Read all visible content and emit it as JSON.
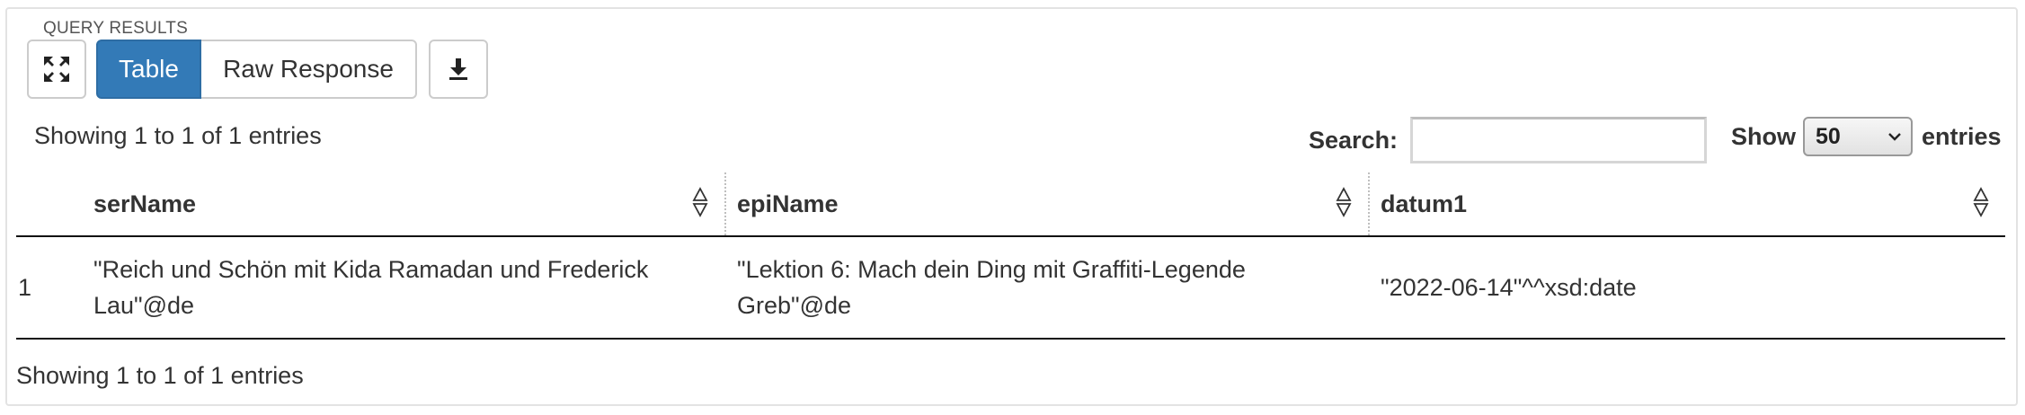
{
  "panel": {
    "legend": "QUERY RESULTS"
  },
  "toolbar": {
    "fullscreen_icon": "expand-icon",
    "table_label": "Table",
    "raw_label": "Raw Response",
    "download_icon": "download-icon",
    "active_color": "#337ab7"
  },
  "info": {
    "top": "Showing 1 to 1 of 1 entries",
    "bottom": "Showing 1 to 1 of 1 entries"
  },
  "search": {
    "label": "Search:",
    "value": ""
  },
  "length": {
    "prefix": "Show",
    "selected": "50",
    "suffix": "entries"
  },
  "table": {
    "columns": [
      {
        "label": ""
      },
      {
        "label": "serName"
      },
      {
        "label": "epiName"
      },
      {
        "label": "datum1"
      }
    ],
    "rows": [
      {
        "index": "1",
        "serName": "\"Reich und Schön mit Kida Ramadan und Frederick Lau\"@de",
        "epiName": "\"Lektion 6: Mach dein Ding mit Graffiti-Legende Greb\"@de",
        "datum1": "\"2022-06-14\"^^xsd:date"
      }
    ]
  }
}
